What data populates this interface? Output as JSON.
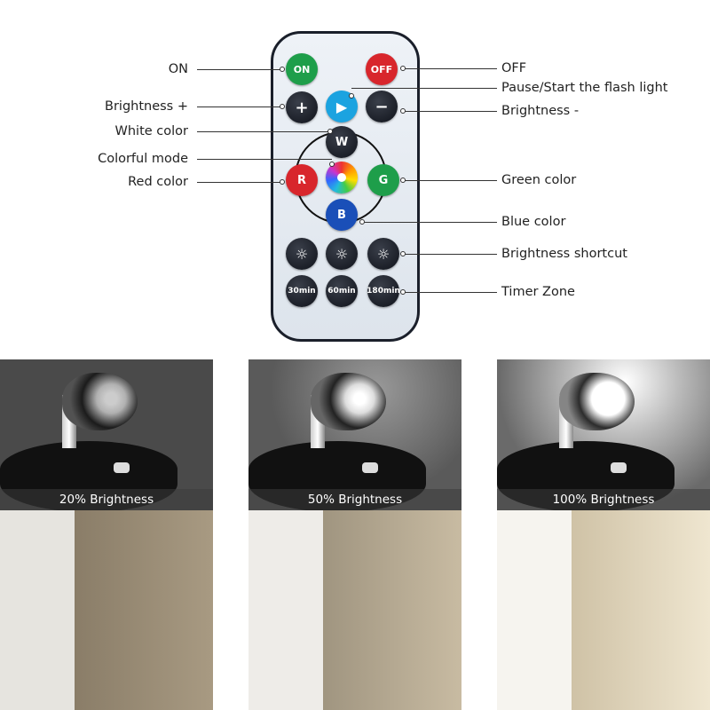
{
  "remote": {
    "buttons": {
      "on": "ON",
      "off": "OFF",
      "plus": "+",
      "minus": "−",
      "white": "W",
      "red": "R",
      "green": "G",
      "blue": "B",
      "timer30": "30min",
      "timer60": "60min",
      "timer180": "180min"
    },
    "icons": {
      "play": "play-icon",
      "colorful": "color-wheel-icon",
      "brightness": "sun-icon"
    },
    "colors": {
      "on": "#1e9e4a",
      "off": "#d8262c",
      "play": "#1ba3e0",
      "red": "#d8262c",
      "green": "#1e9e4a",
      "blue": "#1a4fb8",
      "dark": "#13161e"
    }
  },
  "labels": {
    "left": [
      "ON",
      "Brightness +",
      "White color",
      "Colorful mode",
      "Red color"
    ],
    "right": [
      "OFF",
      "Pause/Start the flash light",
      "Brightness -",
      "Green color",
      "Blue color",
      "Brightness shortcut",
      "Timer Zone"
    ]
  },
  "panels": [
    {
      "caption": "20% Brightness",
      "level": 20
    },
    {
      "caption": "50% Brightness",
      "level": 50
    },
    {
      "caption": "100% Brightness",
      "level": 100
    }
  ]
}
